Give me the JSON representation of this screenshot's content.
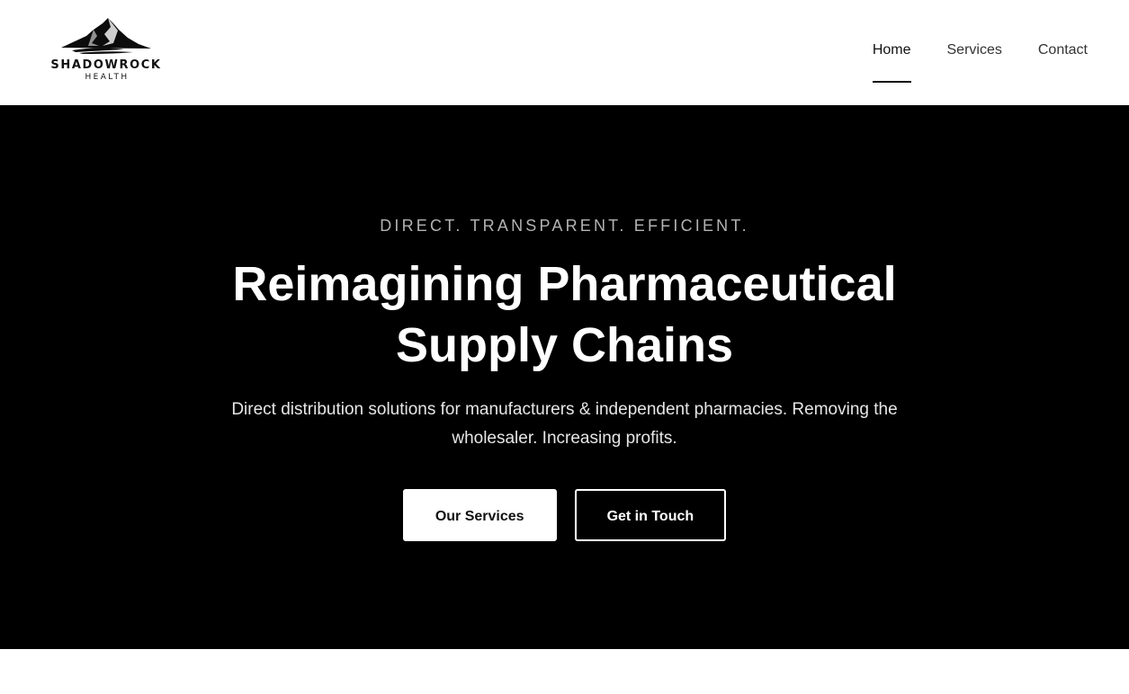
{
  "brand": {
    "name": "SHADOWROCK",
    "subname": "HEALTH"
  },
  "nav": {
    "items": [
      {
        "label": "Home",
        "active": true
      },
      {
        "label": "Services",
        "active": false
      },
      {
        "label": "Contact",
        "active": false
      }
    ]
  },
  "hero": {
    "eyebrow": "DIRECT. TRANSPARENT. EFFICIENT.",
    "title_line1": "Reimagining Pharmaceutical",
    "title_line2": "Supply Chains",
    "subtitle": "Direct distribution solutions for manufacturers & independent pharmacies. Removing the wholesaler. Increasing profits.",
    "primary_button": "Our Services",
    "secondary_button": "Get in Touch"
  },
  "colors": {
    "hero_background": "#000000",
    "page_background": "#ffffff",
    "accent": "#111111"
  },
  "icons": {
    "logo": "mountain-logo-icon"
  }
}
